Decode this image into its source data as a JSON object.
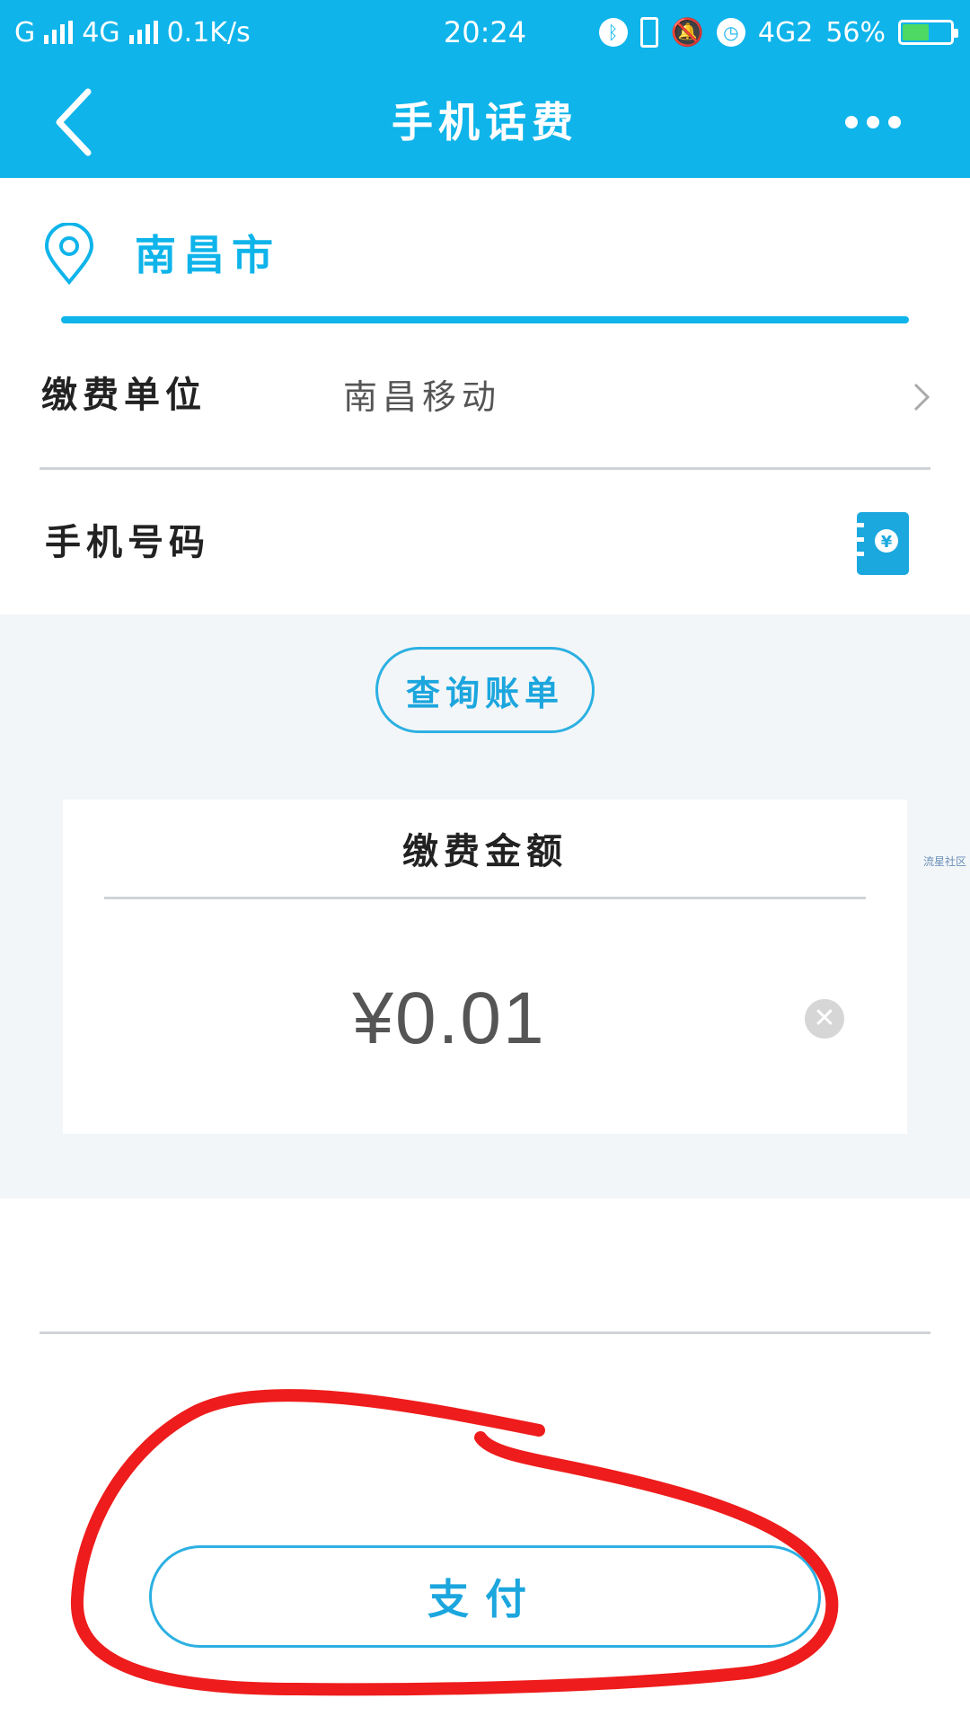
{
  "status_bar": {
    "carrier1": "G",
    "carrier2": "4G",
    "speed": "0.1K/s",
    "time": "20:24",
    "network": "4G2",
    "battery": "56%",
    "battery_level": 0.56
  },
  "header": {
    "title": "手机话费"
  },
  "location": {
    "city": "南昌市"
  },
  "form": {
    "unit_label": "缴费单位",
    "unit_value": "南昌移动",
    "phone_label": "手机号码",
    "phone_value": ""
  },
  "query_button": "查询账单",
  "amount": {
    "title": "缴费金额",
    "value": "¥0.01"
  },
  "watermark": "流星社区",
  "pay_button": "支付",
  "colors": {
    "primary": "#0fb4ea",
    "annotation": "#ee1c1c"
  },
  "icons": {
    "back": "back-arrow-icon",
    "more": "more-dots-icon",
    "location": "location-pin-icon",
    "chevron": "chevron-right-icon",
    "contacts": "contacts-book-icon",
    "clear": "clear-icon"
  }
}
